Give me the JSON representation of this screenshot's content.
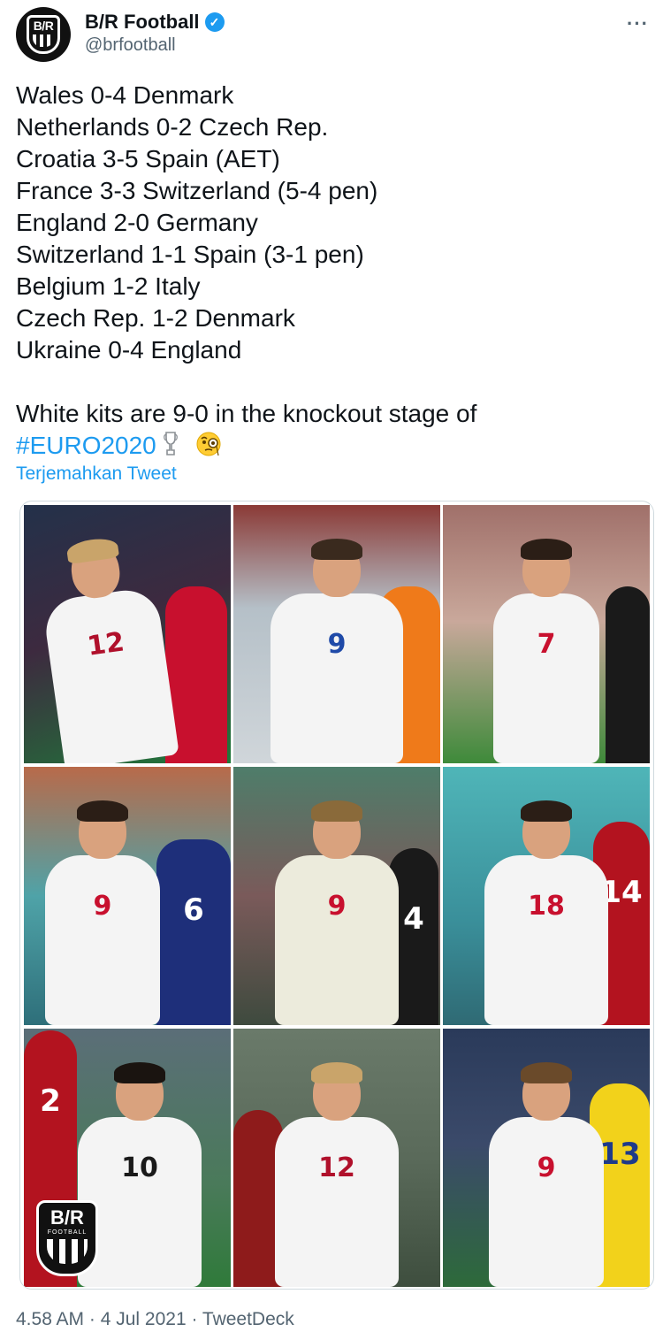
{
  "account": {
    "display_name": "B/R Football",
    "handle": "@brfootball",
    "avatar_text": "B/R",
    "verified_icon": "verified-badge-icon",
    "more_icon": "more-options-icon",
    "more_label": "···"
  },
  "tweet": {
    "lines": [
      "Wales 0-4 Denmark",
      "Netherlands 0-2 Czech Rep.",
      "Croatia 3-5 Spain (AET)",
      "France 3-3 Switzerland (5-4 pen)",
      "England 2-0 Germany",
      "Switzerland 1-1 Spain (3-1 pen)",
      "Belgium 1-2 Italy",
      "Czech Rep. 1-2 Denmark",
      "Ukraine 0-4 England"
    ],
    "summary": "White kits are 9-0 in the knockout stage of",
    "hashtag": "#EURO2020",
    "emoji_icons": [
      "trophy-icon",
      "face-with-monocle-icon"
    ],
    "translate_label": "Terjemahkan Tweet"
  },
  "photos": [
    {
      "num": "12",
      "num_color": "#b0102b",
      "second_num": "",
      "second_color": "#c8102e"
    },
    {
      "num": "9",
      "num_color": "#1f4aa8",
      "second_num": "",
      "second_color": "#ef7a1a"
    },
    {
      "num": "7",
      "num_color": "#c8102e",
      "second_num": "",
      "second_color": "#1a1a1a"
    },
    {
      "num": "9",
      "num_color": "#c8102e",
      "second_num": "6",
      "second_color": "#1e2f7a"
    },
    {
      "num": "9",
      "num_color": "#c8102e",
      "second_num": "4",
      "second_color": "#1a1a1a"
    },
    {
      "num": "18",
      "num_color": "#c8102e",
      "second_num": "14",
      "second_color": "#b3131f"
    },
    {
      "num": "10",
      "num_color": "#1a1a1a",
      "second_num": "2",
      "second_color": "#b3131f"
    },
    {
      "num": "12",
      "num_color": "#b0102b",
      "second_num": "",
      "second_color": "#8e1b1b"
    },
    {
      "num": "9",
      "num_color": "#c8102e",
      "second_num": "13",
      "second_color": "#f2d21b"
    }
  ],
  "overlay_logo": {
    "text": "B/R",
    "sub": "FOOTBALL"
  },
  "footer": {
    "meta": "4.58 AM · 4 Jul 2021 · TweetDeck"
  }
}
